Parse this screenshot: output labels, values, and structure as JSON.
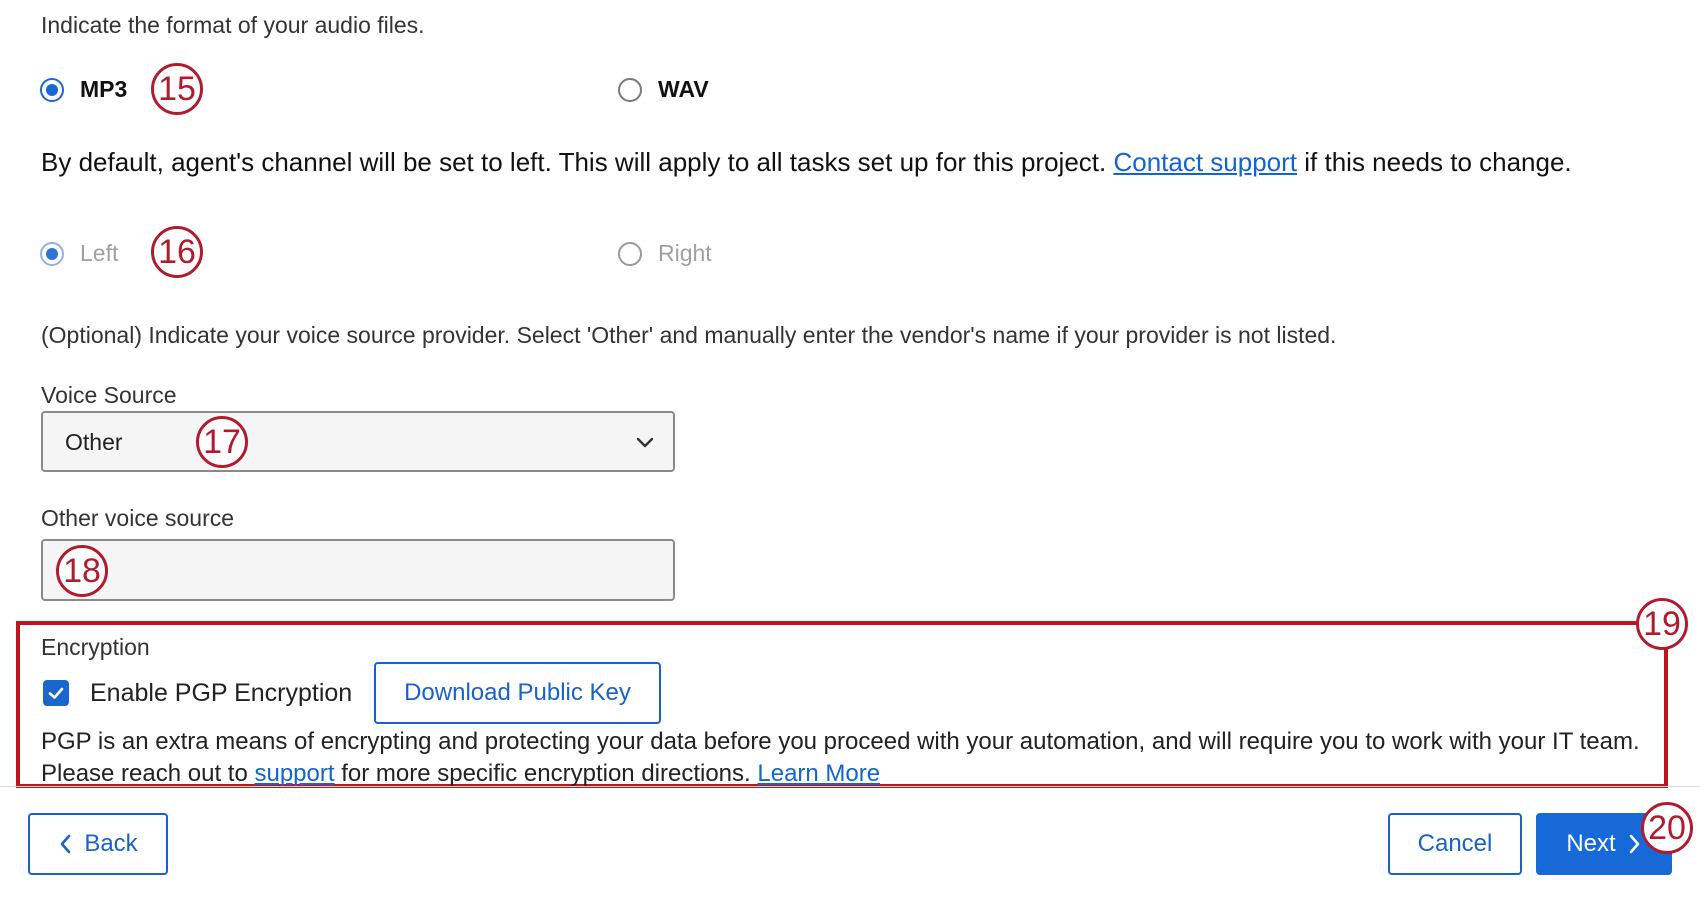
{
  "audio_format": {
    "prompt": "Indicate the format of your audio files.",
    "options": [
      {
        "label": "MP3",
        "selected": true
      },
      {
        "label": "WAV",
        "selected": false
      }
    ]
  },
  "channel": {
    "notice_before": "By default, agent's channel will be set to left. This will apply to all tasks set up for this project. ",
    "link_text": "Contact support",
    "notice_after": " if this needs to change.",
    "options": [
      {
        "label": "Left",
        "selected": true,
        "disabled": true
      },
      {
        "label": "Right",
        "selected": false,
        "disabled": true
      }
    ]
  },
  "voice_source": {
    "prompt": "(Optional) Indicate your voice source provider. Select 'Other' and manually enter the vendor's name if your provider is not listed.",
    "label": "Voice Source",
    "selected_value": "Other",
    "other_label": "Other voice source",
    "other_value": ""
  },
  "encryption": {
    "title": "Encryption",
    "checkbox_label": "Enable PGP Encryption",
    "checked": true,
    "download_button": "Download Public Key",
    "desc_1": "PGP is an extra means of encrypting and protecting your data before you proceed with your automation, and will require you to work with your IT team. Please reach out to ",
    "support_link": "support",
    "desc_2": " for more specific encryption directions. ",
    "learn_more": "Learn More"
  },
  "footer": {
    "back_label": "Back",
    "cancel_label": "Cancel",
    "next_label": "Next"
  },
  "callouts": [
    "15",
    "16",
    "17",
    "18",
    "19",
    "20"
  ],
  "colors": {
    "primary": "#1669d6",
    "link": "#1265cf",
    "callout": "#b01b2e",
    "highlight_box": "#c1121f"
  }
}
